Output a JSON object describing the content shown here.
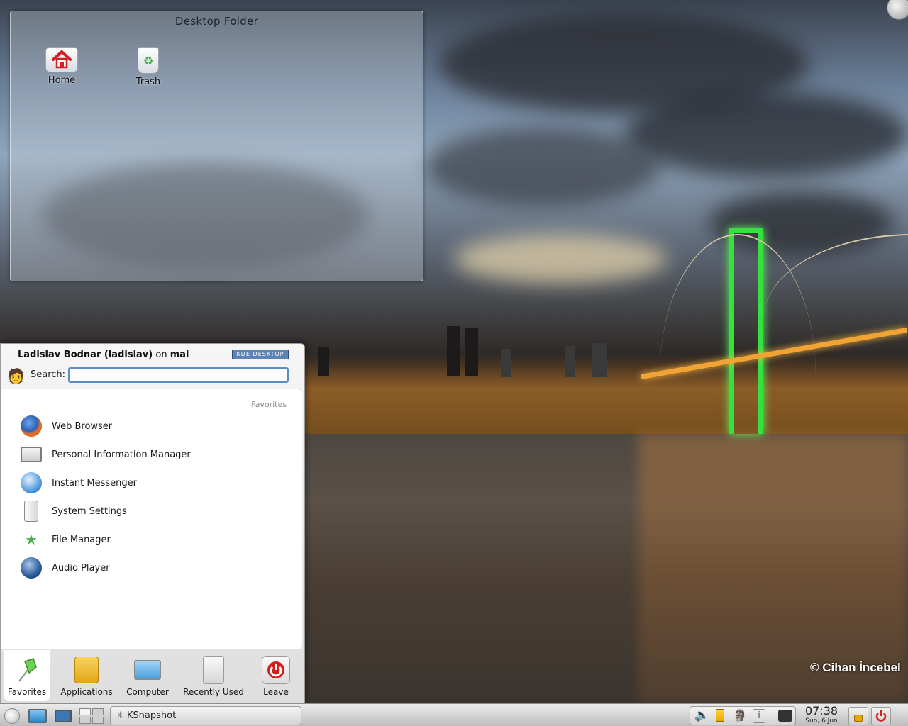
{
  "desktop_folder": {
    "title": "Desktop Folder",
    "icons": [
      {
        "label": "Home",
        "icon": "home-icon"
      },
      {
        "label": "Trash",
        "icon": "trash-icon"
      }
    ]
  },
  "wallpaper": {
    "credit": "© Cihan İncebel"
  },
  "kickoff": {
    "user_name": "Ladislav Bodnar (ladislav)",
    "user_on": "on",
    "host": "mai",
    "logo_text": "KDE DESKTOP",
    "search_label": "Search:",
    "search_value": "",
    "section_title": "Favorites",
    "favorites": [
      {
        "label": "Web Browser",
        "icon": "firefox-icon"
      },
      {
        "label": "Personal Information Manager",
        "icon": "kontact-icon"
      },
      {
        "label": "Instant Messenger",
        "icon": "kopete-icon"
      },
      {
        "label": "System Settings",
        "icon": "settings-icon"
      },
      {
        "label": "File Manager",
        "icon": "dolphin-icon"
      },
      {
        "label": "Audio Player",
        "icon": "amarok-icon"
      }
    ],
    "tabs": [
      {
        "label": "Favorites",
        "icon": "pushpin-icon",
        "active": true
      },
      {
        "label": "Applications",
        "icon": "applications-icon"
      },
      {
        "label": "Computer",
        "icon": "computer-icon"
      },
      {
        "label": "Recently Used",
        "icon": "recently-used-icon"
      },
      {
        "label": "Leave",
        "icon": "power-icon"
      }
    ]
  },
  "panel": {
    "task_label": "KSnapshot",
    "clock_time": "07:38",
    "clock_date": "Sun, 6 Jun"
  },
  "colors": {
    "accent": "#5b8ec8",
    "leave_red": "#d21f1f",
    "bridge_green": "#36e03f"
  }
}
